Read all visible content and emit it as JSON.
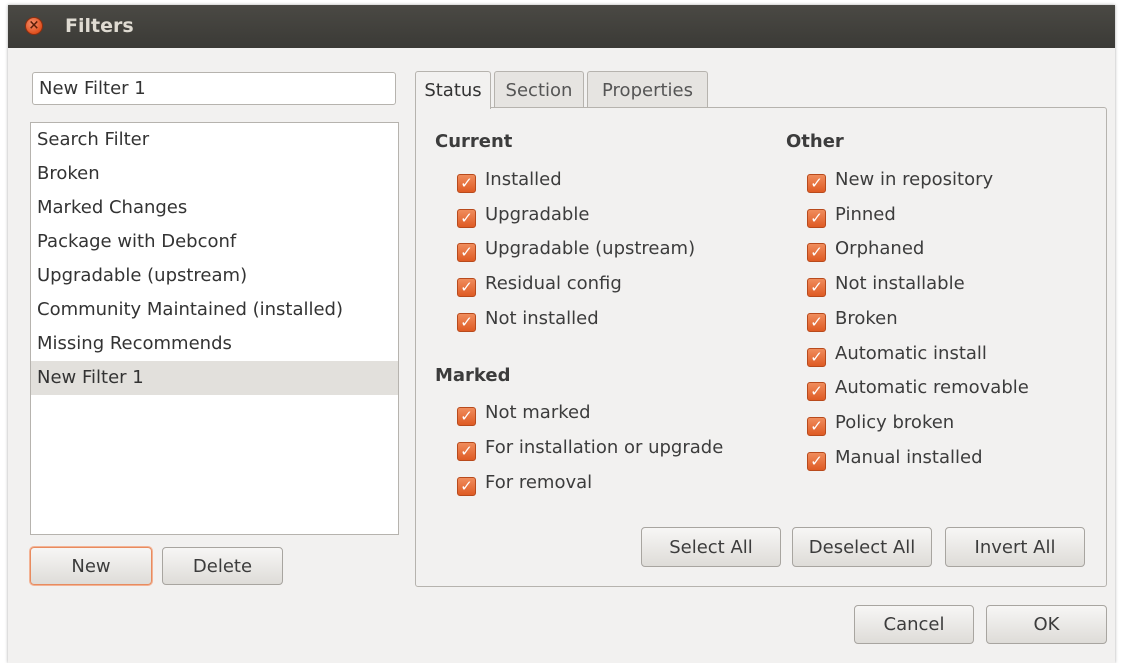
{
  "window": {
    "title": "Filters",
    "close_glyph": "×"
  },
  "name_field": {
    "value": "New Filter 1"
  },
  "filter_list": {
    "items": [
      "Search Filter",
      "Broken",
      "Marked Changes",
      "Package with Debconf",
      "Upgradable (upstream)",
      "Community Maintained (installed)",
      "Missing Recommends",
      "New Filter 1"
    ],
    "selected_index": 7
  },
  "list_buttons": {
    "new_label": "New",
    "delete_label": "Delete"
  },
  "tabs": [
    {
      "label": "Status",
      "active": true
    },
    {
      "label": "Section",
      "active": false
    },
    {
      "label": "Properties",
      "active": false
    }
  ],
  "status": {
    "current": {
      "title": "Current",
      "items": [
        {
          "label": "Installed",
          "checked": true
        },
        {
          "label": "Upgradable",
          "checked": true
        },
        {
          "label": "Upgradable (upstream)",
          "checked": true
        },
        {
          "label": "Residual config",
          "checked": true
        },
        {
          "label": "Not installed",
          "checked": true
        }
      ]
    },
    "marked": {
      "title": "Marked",
      "items": [
        {
          "label": "Not marked",
          "checked": true
        },
        {
          "label": "For installation or upgrade",
          "checked": true
        },
        {
          "label": "For removal",
          "checked": true
        }
      ]
    },
    "other": {
      "title": "Other",
      "items": [
        {
          "label": "New in repository",
          "checked": true
        },
        {
          "label": "Pinned",
          "checked": true
        },
        {
          "label": "Orphaned",
          "checked": true
        },
        {
          "label": "Not installable",
          "checked": true
        },
        {
          "label": "Broken",
          "checked": true
        },
        {
          "label": "Automatic install",
          "checked": true
        },
        {
          "label": "Automatic removable",
          "checked": true
        },
        {
          "label": "Policy broken",
          "checked": true
        },
        {
          "label": "Manual installed",
          "checked": true
        }
      ]
    },
    "buttons": {
      "select_all": "Select All",
      "deselect_all": "Deselect All",
      "invert_all": "Invert All"
    }
  },
  "dialog_buttons": {
    "cancel_label": "Cancel",
    "ok_label": "OK"
  },
  "colors": {
    "checkbox": "#e5652f",
    "titlebar": "#3c3b37",
    "window_bg": "#f2f1f0",
    "close_button": "#e9541f"
  },
  "check_glyph": "✓"
}
